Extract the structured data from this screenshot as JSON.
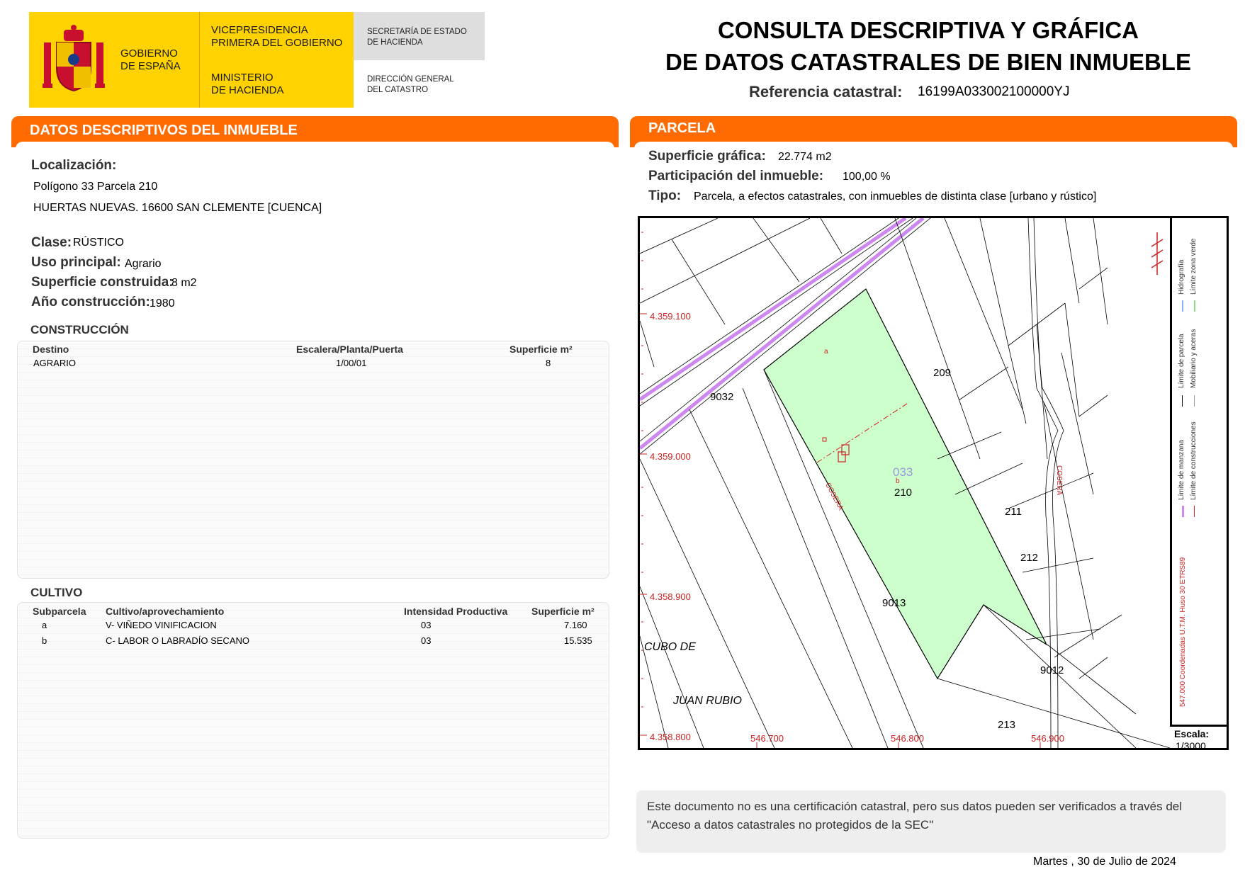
{
  "header": {
    "gobierno": "GOBIERNO\nDE ESPAÑA",
    "vicepresidencia": "VICEPRESIDENCIA\nPRIMERA DEL GOBIERNO",
    "ministerio": "MINISTERIO\nDE HACIENDA",
    "secretaria": "SECRETARÍA DE ESTADO\nDE HACIENDA",
    "direccion": "DIRECCIÓN GENERAL\nDEL CATASTRO",
    "title_line1": "CONSULTA DESCRIPTIVA Y GRÁFICA",
    "title_line2": "DE DATOS CATASTRALES DE BIEN INMUEBLE",
    "ref_label": "Referencia catastral:",
    "ref_value": "16199A033002100000YJ"
  },
  "descriptivos": {
    "section_title": "DATOS DESCRIPTIVOS DEL INMUEBLE",
    "localizacion_label": "Localización:",
    "localizacion_line1": "Polígono 33 Parcela 210",
    "localizacion_line2": "HUERTAS NUEVAS. 16600 SAN CLEMENTE [CUENCA]",
    "clase_label": "Clase:",
    "clase_value": "RÚSTICO",
    "uso_label": "Uso principal:",
    "uso_value": "Agrario",
    "superficie_label": "Superficie construida:",
    "superficie_value": "8 m2",
    "anio_label": "Año construcción:",
    "anio_value": "1980"
  },
  "construccion": {
    "title": "CONSTRUCCIÓN",
    "headers": [
      "Destino",
      "Escalera/Planta/Puerta",
      "Superficie m²"
    ],
    "rows": [
      [
        "AGRARIO",
        "1/00/01",
        "8"
      ]
    ]
  },
  "cultivo": {
    "title": "CULTIVO",
    "headers": [
      "Subparcela",
      "Cultivo/aprovechamiento",
      "Intensidad Productiva",
      "Superficie m²"
    ],
    "rows": [
      [
        "a",
        "V- VIÑEDO VINIFICACION",
        "03",
        "7.160"
      ],
      [
        "b",
        "C- LABOR O LABRADÍO  SECANO",
        "03",
        "15.535"
      ]
    ]
  },
  "parcela": {
    "section_title": "PARCELA",
    "sup_grafica_label": "Superficie gráfica:",
    "sup_grafica_value": "22.774 m2",
    "participacion_label": "Participación del inmueble:",
    "participacion_value": "100,00 %",
    "tipo_label": "Tipo:",
    "tipo_value": "Parcela, a efectos catastrales, con inmuebles de distinta clase [urbano y rústico]"
  },
  "map": {
    "y_coords": [
      "4.359.100",
      "4.359.000",
      "4.358.900",
      "4.358.800"
    ],
    "x_coords": [
      "546.700",
      "546.800",
      "546.900"
    ],
    "labels": {
      "p209": "209",
      "p210": "210",
      "p211": "211",
      "p212": "212",
      "p213": "213",
      "p9032": "9032",
      "p9013": "9013",
      "p9012": "9012",
      "pol033": "033",
      "sub_a": "a",
      "sub_b": "b",
      "cosera1": "COSERA",
      "cosera2": "COSERA",
      "cubo": "CUBO DE",
      "juan": "JUAN RUBIO"
    },
    "legend": {
      "manzana": "Límite de manzana",
      "parcela": "Límite de parcela",
      "hidrografia": "Hidrografía",
      "construcciones": "Límite de construcciones",
      "mobiliario": "Mobiliario y aceras",
      "zona_verde": "Límite zona verde",
      "coords": "547.000 Coordenadas U.T.M. Huso 30 ETRS89"
    },
    "scale_label": "Escala:",
    "scale_value": "1/3000",
    "colors": {
      "parcel_fill": "#ccffcc",
      "road": "#cc88ee",
      "coord_red": "#cc2222",
      "polygon_label": "#9999dd"
    }
  },
  "footer": {
    "note": "Este documento no es una certificación catastral, pero sus datos pueden ser verificados a través del \"Acceso a datos catastrales no protegidos de la SEC\"",
    "date": "Martes , 30 de Julio de 2024"
  }
}
